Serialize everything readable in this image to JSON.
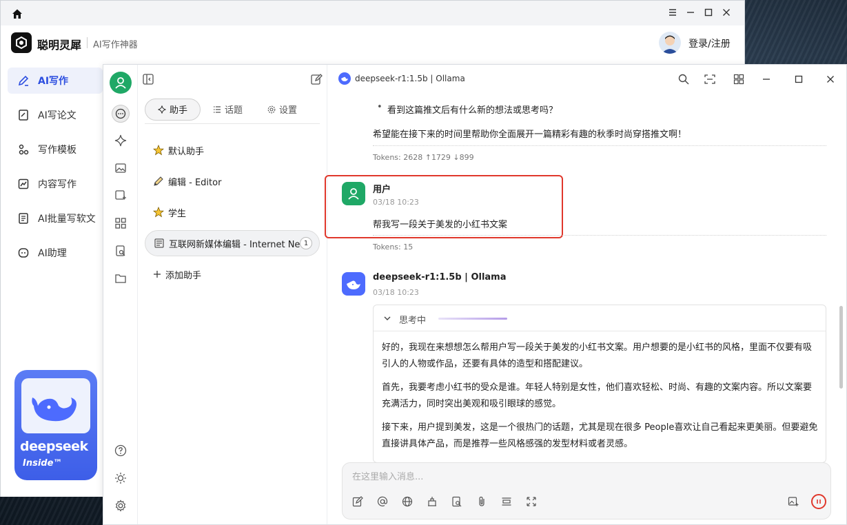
{
  "outer": {
    "brand_name": "聪明灵犀",
    "brand_sub": "AI写作神器",
    "login": "登录/注册",
    "nav": [
      {
        "label": "AI写作"
      },
      {
        "label": "AI写论文"
      },
      {
        "label": "写作模板"
      },
      {
        "label": "内容写作"
      },
      {
        "label": "AI批量写软文"
      },
      {
        "label": "AI助理"
      }
    ],
    "promo_word": "deepseek",
    "promo_inside": "Inside™"
  },
  "assistants": {
    "tabs": [
      {
        "label": "助手"
      },
      {
        "label": "话题"
      },
      {
        "label": "设置"
      }
    ],
    "items": [
      {
        "label": "默认助手"
      },
      {
        "label": "编辑 - Editor"
      },
      {
        "label": "学生"
      },
      {
        "label": "互联网新媒体编辑 - Internet New",
        "badge": "1"
      }
    ],
    "add_label": "添加助手"
  },
  "chat": {
    "model_title": "deepseek-r1:1.5b | Ollama",
    "prev_bullet": "看到这篇推文后有什么新的想法或思考吗？",
    "prev_closing": "希望能在接下来的时间里帮助你全面展开一篇精彩有趣的秋季时尚穿搭推文啊！",
    "prev_tokens": "Tokens: 2628 ↑1729 ↓899",
    "user_msg": {
      "name": "用户",
      "time": "03/18 10:23",
      "text": "帮我写一段关于美发的小红书文案",
      "tokens": "Tokens: 15"
    },
    "bot_msg": {
      "name": "deepseek-r1:1.5b | Ollama",
      "time": "03/18 10:23",
      "thinking_label": "思考中",
      "paragraphs": [
        "好的，我现在来想想怎么帮用户写一段关于美发的小红书文案。用户想要的是小红书的风格，里面不仅要有吸引人的人物或作品，还要有具体的造型和搭配建议。",
        "首先，我要考虑小红书的受众是谁。年轻人特别是女性，他们喜欢轻松、时尚、有趣的文案内容。所以文案要充满活力，同时突出美观和吸引眼球的感觉。",
        "接下来，用户提到美发，这是一个很热门的话题，尤其是现在很多 People喜欢让自己看起来更美丽。但要避免直接讲具体产品，而是推荐一些风格感强的发型材料或者灵感。"
      ]
    },
    "input_placeholder": "在这里输入消息..."
  },
  "colors": {
    "accent": "#2d4fe0",
    "green": "#1fa866",
    "deepseek": "#4d6bfe",
    "highlight": "#e0372b"
  }
}
